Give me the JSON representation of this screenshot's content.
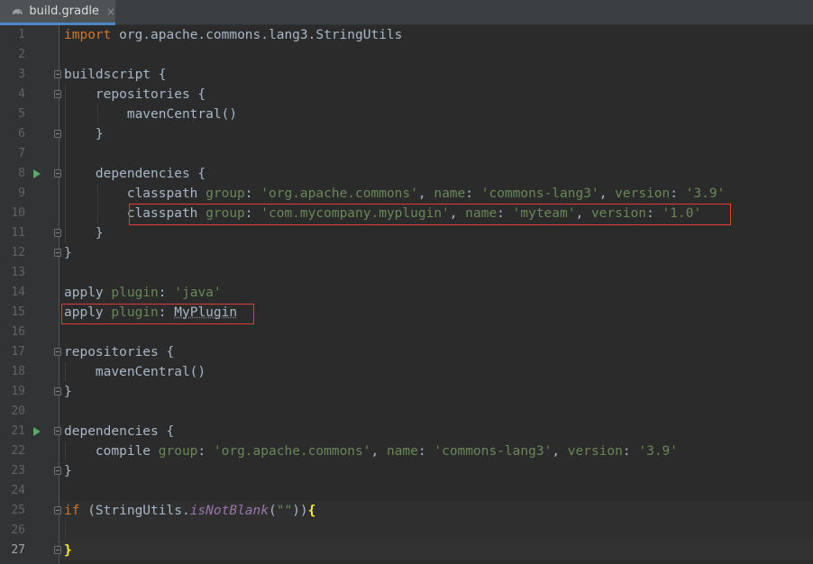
{
  "tab": {
    "filename": "build.gradle",
    "icon": "gradle-elephant-icon",
    "close_glyph": "×"
  },
  "line_numbers": [
    "1",
    "2",
    "3",
    "4",
    "5",
    "6",
    "7",
    "8",
    "9",
    "10",
    "11",
    "12",
    "13",
    "14",
    "15",
    "16",
    "17",
    "18",
    "19",
    "20",
    "21",
    "22",
    "23",
    "24",
    "25",
    "26",
    "27"
  ],
  "code": {
    "l1": {
      "kw": "import",
      "rest": " org.apache.commons.lang3.StringUtils"
    },
    "l3": "buildscript {",
    "l4": "    repositories {",
    "l5": "        mavenCentral()",
    "l6": "    }",
    "l8": "    dependencies {",
    "l9": {
      "pre": "        classpath ",
      "k1": "group",
      "s1": "'org.apache.commons'",
      "k2": "name",
      "s2": "'commons-lang3'",
      "k3": "version",
      "s3": "'3.9'"
    },
    "l10": {
      "pre": "        classpath ",
      "k1": "group",
      "s1": "'com.mycompany.myplugin'",
      "k2": "name",
      "s2": "'myteam'",
      "k3": "version",
      "s3": "'1.0'"
    },
    "l11": "    }",
    "l12": "}",
    "l14": {
      "pre": "apply ",
      "k1": "plugin",
      "s1": "'java'"
    },
    "l15": {
      "pre": "apply ",
      "k1": "plugin",
      "v1": "MyPlugin"
    },
    "l17": "repositories {",
    "l18": "    mavenCentral()",
    "l19": "}",
    "l21": "dependencies {",
    "l22": {
      "pre": "    compile ",
      "k1": "group",
      "s1": "'org.apache.commons'",
      "k2": "name",
      "s2": "'commons-lang3'",
      "k3": "version",
      "s3": "'3.9'"
    },
    "l23": "}",
    "l25": {
      "kw": "if",
      "p1": " (StringUtils.",
      "m1": "isNotBlank",
      "p2": "(",
      "s1": "\"\"",
      "p3": "))",
      "brace": "{"
    },
    "l27": "}"
  },
  "colors": {
    "keyword": "#cc7832",
    "string": "#6a8759",
    "text": "#a9b7c6",
    "static_method": "#9876aa",
    "highlight_box": "#e03c3c",
    "run_gutter": "#59a869"
  }
}
